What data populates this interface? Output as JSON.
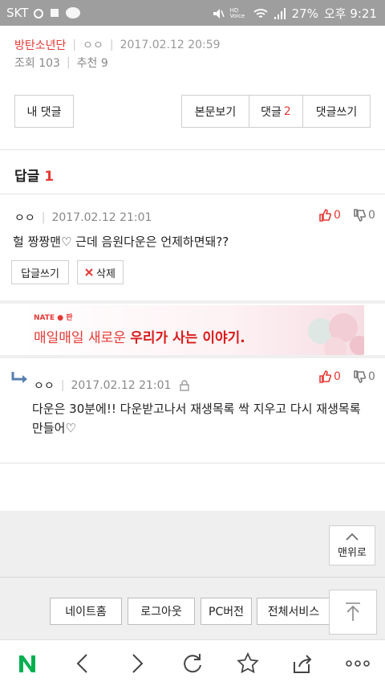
{
  "status_bar": {
    "carrier": "SKT",
    "battery": "27%",
    "time": "오후 9:21",
    "hd_label": "HD Voice"
  },
  "post": {
    "group": "방탄소년단",
    "author": "ㅇㅇ",
    "datetime": "2017.02.12 20:59",
    "views": "조회 103",
    "recommend": "추천 9"
  },
  "toolbar": {
    "my_comments": "내 댓글",
    "view_post": "본문보기",
    "comments_label": "댓글",
    "comments_count": "2",
    "write_comment": "댓글쓰기"
  },
  "replies": {
    "title": "답글",
    "count": "1"
  },
  "comments": [
    {
      "author": "ㅇㅇ",
      "datetime": "2017.02.12 21:01",
      "text": "헐 짱짱맨♡ 근데 음원다운은 언제하면돼??",
      "likes": "0",
      "dislikes": "0",
      "reply_button": "답글쓰기",
      "delete_button": "삭제"
    },
    {
      "author": "ㅇㅇ",
      "datetime": "2017.02.12 21:01",
      "text": "다운은 30분에!! 다운받고나서 재생목록 싹 지우고 다시 재생목록 만들어♡",
      "likes": "0",
      "dislikes": "0"
    }
  ],
  "ad": {
    "brand": "NATE ● 판",
    "tagline_plain": "매일매일 새로운 ",
    "tagline_bold": "우리가 사는 이야기."
  },
  "top_button": {
    "label": "맨위로"
  },
  "footer": {
    "links": [
      "네이트홈",
      "로그아웃",
      "PC버전",
      "전체서비스"
    ]
  },
  "colors": {
    "accent": "#e53935",
    "navbar_logo": "#00b050"
  }
}
